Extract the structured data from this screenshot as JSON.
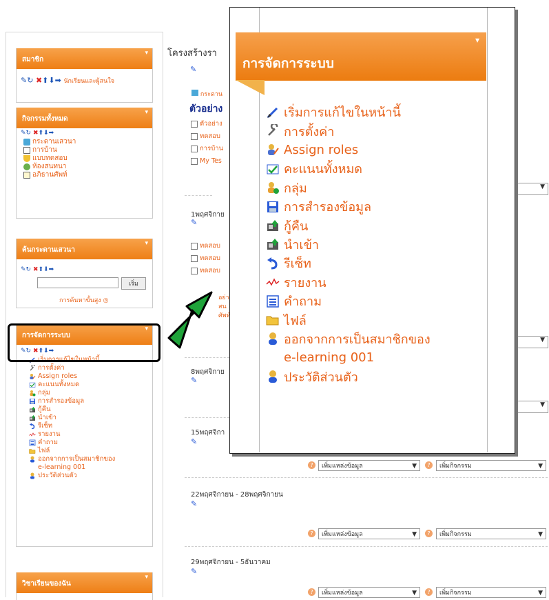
{
  "center": {
    "title": "โครงสร้างรา",
    "forum_link": "กระดาน",
    "example_title": "ตัวอย่าง",
    "items1": [
      "ตัวอย่าง",
      "ทดสอบ",
      "การบ้าน",
      "My Tes"
    ],
    "week1": "1พฤศจิกาย",
    "week1_items": [
      "ทดสอบ",
      "ทดสอบ",
      "ทดสอบ"
    ],
    "week1_extra": [
      "อย่าง",
      "สน",
      "ศัพท์"
    ],
    "week2": "8พฤศจิกาย",
    "week3": "15พฤศจิกา",
    "week4": "22พฤศจิกายน - 28พฤศจิกายน",
    "week5": "29พฤศจิกายน - 5ธันวาคม",
    "add_resource": "เพิ่มแหล่งข้อมูล",
    "add_activity": "เพิ่มกิจกรรม"
  },
  "left": {
    "members": {
      "title": "สมาชิก",
      "item": "นักเรียนและผู้สนใจ"
    },
    "activities": {
      "title": "กิจกรรมทั้งหมด",
      "items": [
        "กระดานเสวนา",
        "การบ้าน",
        "แบบทดสอบ",
        "ห้องสนทนา",
        "อภิธานศัพท์"
      ]
    },
    "search": {
      "title": "ค้นกระดานเสวนา",
      "button": "เริ่ม",
      "advanced": "การค้นหาขั้นสูง"
    },
    "admin": {
      "title": "การจัดการระบบ",
      "items": [
        "เริ่มการแก้ไขในหน้านี้",
        "การตั้งค่า",
        "Assign roles",
        "คะแนนทั้งหมด",
        "กลุ่ม",
        "การสำรองข้อมูล",
        "กู้คืน",
        "นำเข้า",
        "รีเซ็ท",
        "รายงาน",
        "คำถาม",
        "ไฟล์",
        "ออกจากการเป็นสมาชิกของ",
        "e-learning 001",
        "ประวัติส่วนตัว"
      ]
    },
    "courses": {
      "title": "วิชาเรียนของฉัน"
    }
  },
  "popup": {
    "title": "การจัดการระบบ",
    "items": [
      {
        "label": "เริ่มการแก้ไขในหน้านี้",
        "icon": "pencil-icon"
      },
      {
        "label": "การตั้งค่า",
        "icon": "wrench-icon"
      },
      {
        "label": "Assign roles",
        "icon": "roles-icon"
      },
      {
        "label": "คะแนนทั้งหมด",
        "icon": "grades-icon"
      },
      {
        "label": "กลุ่ม",
        "icon": "group-icon"
      },
      {
        "label": "การสำรองข้อมูล",
        "icon": "backup-icon"
      },
      {
        "label": "กู้คืน",
        "icon": "restore-icon"
      },
      {
        "label": "นำเข้า",
        "icon": "import-icon"
      },
      {
        "label": "รีเซ็ท",
        "icon": "reset-icon"
      },
      {
        "label": "รายงาน",
        "icon": "report-icon"
      },
      {
        "label": "คำถาม",
        "icon": "questions-icon"
      },
      {
        "label": "ไฟล์",
        "icon": "folder-icon"
      },
      {
        "label": "ออกจากการเป็นสมาชิกของ",
        "icon": "user-icon"
      },
      {
        "label": "e-learning 001",
        "icon": ""
      },
      {
        "label": "ประวัติส่วนตัว",
        "icon": "user-icon"
      }
    ]
  },
  "colors": {
    "orange": "#ee7f16",
    "link": "#e8621a",
    "arrow": "#1fa33a"
  }
}
